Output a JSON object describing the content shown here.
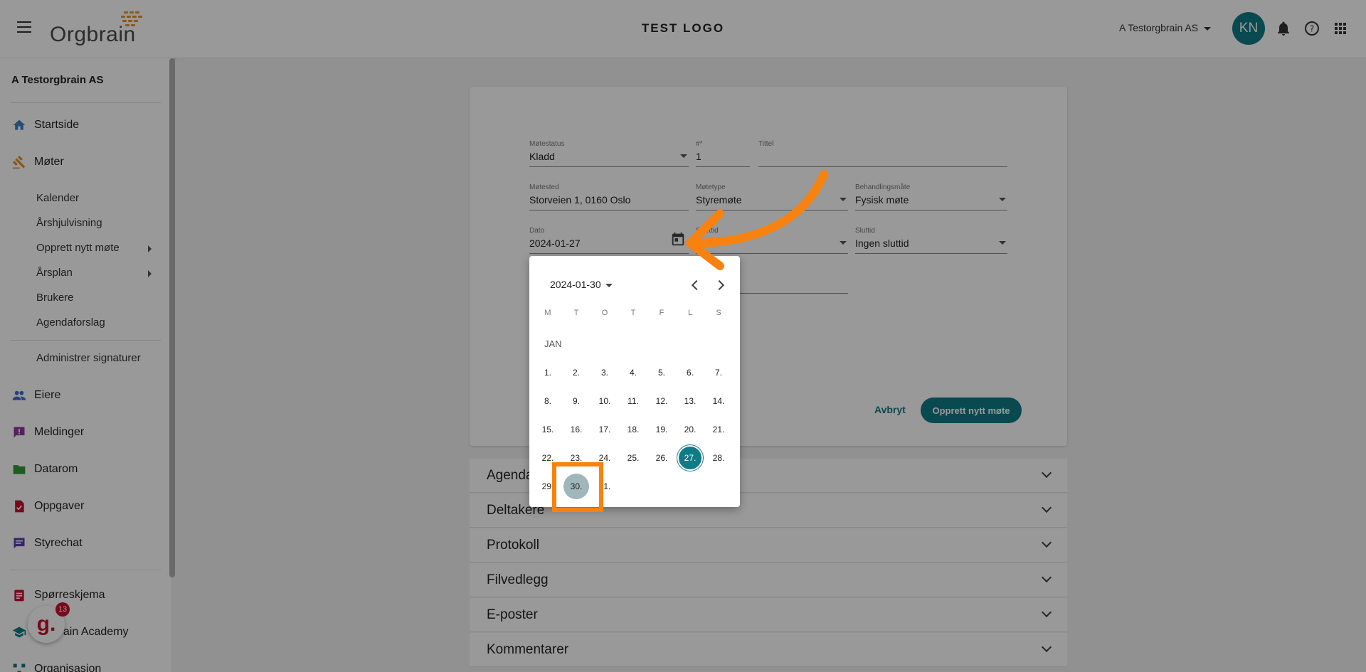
{
  "topbar": {
    "logo_text": "Orgbrain",
    "title": "TEST LOGO",
    "org_name": "A Testorgbrain AS",
    "avatar_initials": "KN"
  },
  "sidebar": {
    "org_name": "A Testorgbrain AS",
    "items": [
      {
        "label": "Startside",
        "icon": "home-icon",
        "color": "#3b82c4"
      },
      {
        "label": "Møter",
        "icon": "gavel-icon",
        "color": "#e8932c"
      }
    ],
    "sub_items": [
      {
        "label": "Kalender"
      },
      {
        "label": "Årshjulvisning"
      },
      {
        "label": "Opprett nytt møte"
      },
      {
        "label": "Årsplan"
      },
      {
        "label": "Brukere"
      },
      {
        "label": "Agendaforslag"
      }
    ],
    "admin_label": "Administrer signaturer",
    "lower_items": [
      {
        "label": "Eiere",
        "icon": "people-icon",
        "color": "#3b6fd4"
      },
      {
        "label": "Meldinger",
        "icon": "message-icon",
        "color": "#8e3b9e"
      },
      {
        "label": "Datarom",
        "icon": "folder-icon",
        "color": "#2e9a3a"
      },
      {
        "label": "Oppgaver",
        "icon": "task-icon",
        "color": "#c8102e"
      },
      {
        "label": "Styrechat",
        "icon": "chat-icon",
        "color": "#5b3fb0"
      },
      {
        "label": "Spørreskjema",
        "icon": "clipboard-icon",
        "color": "#c8102e"
      },
      {
        "label": "Orgbrain Academy",
        "icon": "academy-icon",
        "color": "#0f7b86"
      },
      {
        "label": "Organisasjon",
        "icon": "org-icon",
        "color": "#0f7b86"
      }
    ]
  },
  "form": {
    "status_label": "Møtestatus",
    "status_value": "Kladd",
    "number_label": "#*",
    "number_value": "1",
    "title_label": "Tittel",
    "title_value": "",
    "place_label": "Møtested",
    "place_value": "Storveien 1, 0160 Oslo",
    "type_label": "Møtetype",
    "type_value": "Styremøte",
    "mode_label": "Behandlingsmåte",
    "mode_value": "Fysisk møte",
    "date_label": "Dato",
    "date_value": "2024-01-27",
    "start_label": "Starttid",
    "start_value": "",
    "end_label": "Sluttid",
    "end_value": "Ingen sluttid",
    "cancel_label": "Avbryt",
    "create_label": "Opprett nytt møte"
  },
  "accordions": [
    {
      "label": "Agenda"
    },
    {
      "label": "Deltakere"
    },
    {
      "label": "Protokoll"
    },
    {
      "label": "Filvedlegg"
    },
    {
      "label": "E-poster"
    },
    {
      "label": "Kommentarer"
    }
  ],
  "datepicker": {
    "header": "2024-01-30",
    "weekdays": [
      "M",
      "T",
      "O",
      "T",
      "F",
      "L",
      "S"
    ],
    "month_label": "JAN",
    "selected_day": "27.",
    "hover_day": "30.",
    "days": [
      "1.",
      "2.",
      "3.",
      "4.",
      "5.",
      "6.",
      "7.",
      "8.",
      "9.",
      "10.",
      "11.",
      "12.",
      "13.",
      "14.",
      "15.",
      "16.",
      "17.",
      "18.",
      "19.",
      "20.",
      "21.",
      "22.",
      "23.",
      "24.",
      "25.",
      "26.",
      "27.",
      "28.",
      "29.",
      "30.",
      "31."
    ]
  },
  "badge": {
    "letter": "g.",
    "count": "13"
  }
}
